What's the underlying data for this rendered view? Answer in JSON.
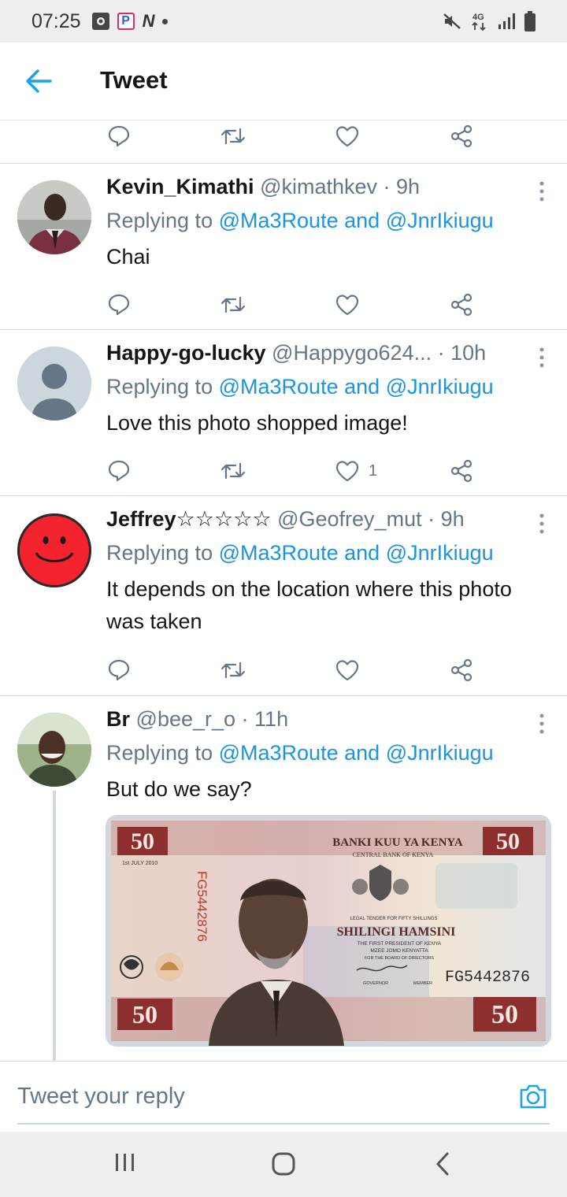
{
  "status_bar": {
    "time": "07:25",
    "network": "4G",
    "icons": [
      "notification-icon",
      "p-app-icon",
      "n-app-icon",
      "dot-icon",
      "mute-icon",
      "network-icon",
      "signal-icon",
      "battery-icon"
    ]
  },
  "header": {
    "title": "Tweet",
    "back_icon": "arrow-left-icon"
  },
  "tweets": [
    {
      "name": "Kevin_Kimathi",
      "handle": "@kimathkev",
      "time": "· 9h",
      "replying_prefix": "Replying to",
      "reply_to_1": "@Ma3Route",
      "reply_and": "and",
      "reply_to_2": "@JnrIkiugu",
      "text": "Chai",
      "likes": ""
    },
    {
      "name": "Happy-go-lucky",
      "handle": "@Happygo624...",
      "time": "· 10h",
      "replying_prefix": "Replying to",
      "reply_to_1": "@Ma3Route",
      "reply_and": "and",
      "reply_to_2": "@JnrIkiugu",
      "text": "Love this photo shopped image!",
      "likes": "1"
    },
    {
      "name": "Jeffrey☆☆☆☆☆",
      "handle": "@Geofrey_mut",
      "time": "· 9h",
      "replying_prefix": "Replying to",
      "reply_to_1": "@Ma3Route",
      "reply_and": "and",
      "reply_to_2": "@JnrIkiugu",
      "text": "It depends on the location where this photo was taken",
      "likes": ""
    },
    {
      "name": "Br",
      "handle": "@bee_r_o",
      "time": "· 11h",
      "replying_prefix": "Replying to",
      "reply_to_1": "@Ma3Route",
      "reply_and": "and",
      "reply_to_2": "@JnrIkiugu",
      "text": "But do we say?",
      "likes": ""
    }
  ],
  "banknote": {
    "denomination": "50",
    "bank_name": "BANKI KUU YA KENYA",
    "bank_name_en": "CENTRAL BANK OF KENYA",
    "date": "1st JULY 2010",
    "serial": "FG5442876",
    "legal_tender": "LEGAL TENDER FOR FIFTY SHILLINGS",
    "words": "SHILINGI HAMSINI",
    "president_line1": "THE FIRST PRESIDENT OF KENYA",
    "president_line2": "MZEE JOMO KENYATTA",
    "board": "FOR THE BOARD OF DIRECTORS",
    "gov": "GOVERNOR",
    "member": "MEMBER"
  },
  "composer": {
    "placeholder": "Tweet your reply",
    "camera_icon": "camera-icon"
  },
  "nav_bar": {
    "icons": [
      "recent-apps-icon",
      "home-icon",
      "back-icon"
    ]
  },
  "colors": {
    "link_blue": "#1b95e0",
    "secondary_text": "#657786",
    "divider": "#d8dee3",
    "statusbar_bg": "#eeeeee"
  }
}
